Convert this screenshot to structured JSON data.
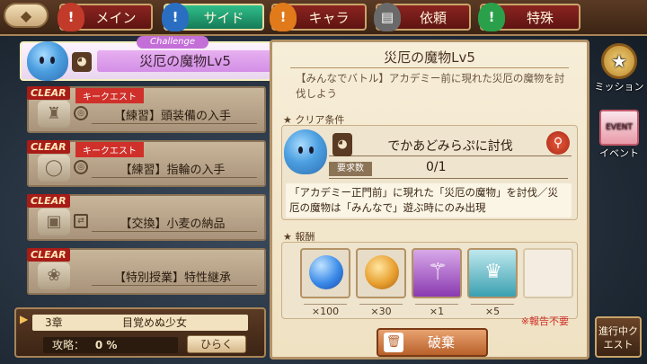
{
  "tabs": [
    {
      "label": "メイン",
      "icon": "!",
      "color": "#c23a2a",
      "active": false
    },
    {
      "label": "サイド",
      "icon": "!",
      "color": "#2a6ec2",
      "active": true
    },
    {
      "label": "キャラ",
      "icon": "!",
      "color": "#e07a1a",
      "active": false
    },
    {
      "label": "依頼",
      "icon": "▤",
      "color": "#6a6a6a",
      "active": false
    },
    {
      "label": "特殊",
      "icon": "!",
      "color": "#2aa04a",
      "active": false
    }
  ],
  "featured": {
    "tag": "Challenge",
    "name": "災厄の魔物Lv5"
  },
  "quests": [
    {
      "clear": "CLEAR",
      "key": "キークエスト",
      "name": "【練習】頭装備の入手"
    },
    {
      "clear": "CLEAR",
      "key": "キークエスト",
      "name": "【練習】指輪の入手"
    },
    {
      "clear": "CLEAR",
      "key": "",
      "name": "【交換】小麦の納品"
    },
    {
      "clear": "CLEAR",
      "key": "",
      "name": "【特別授業】特性継承"
    }
  ],
  "chapter": {
    "number": "3章",
    "title": "目覚めぬ少女",
    "progress_label": "攻略：",
    "progress_value": "0 %",
    "open_label": "ひらく"
  },
  "detail": {
    "title": "災厄の魔物Lv5",
    "description": "【みんなでバトル】アカデミー前に現れた災厄の魔物を討伐しよう",
    "condition_header": "クリア条件",
    "target": "でかあどみらぷに討伐",
    "required_label": "要求数",
    "required_value": "0/1",
    "note": "「アカデミー正門前」に現れた「災厄の魔物」を討伐／災厄の魔物は「みんなで」遊ぶ時にのみ出現",
    "reward_header": "報酬",
    "rewards": [
      {
        "qty": "×100",
        "color": "#3a8ae8"
      },
      {
        "qty": "×30",
        "color": "#e8a030"
      },
      {
        "qty": "×1",
        "color": "#b03ad0"
      },
      {
        "qty": "×5",
        "color": "#3aa0b0"
      }
    ],
    "no_report": "※報告不要",
    "destroy_label": "破棄"
  },
  "side": {
    "mission_label": "ミッション",
    "event_label": "イベント",
    "event_card_text": "EVENT",
    "progress_quest_label": "進行中クエスト"
  }
}
